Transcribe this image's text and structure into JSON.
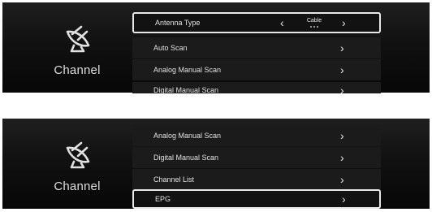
{
  "panels": [
    {
      "sidebar": {
        "icon": "satellite-dish-icon",
        "label": "Channel"
      },
      "menu": [
        {
          "label": "Antenna Type",
          "value": "Cable",
          "selected": true
        },
        {
          "label": "Auto Scan"
        },
        {
          "label": "Analog Manual Scan"
        },
        {
          "label": "Digital Manual Scan"
        }
      ]
    },
    {
      "sidebar": {
        "icon": "satellite-dish-icon",
        "label": "Channel"
      },
      "menu": [
        {
          "label": "Analog Manual Scan"
        },
        {
          "label": "Digital Manual Scan"
        },
        {
          "label": "Channel List"
        },
        {
          "label": "EPG",
          "selected": true
        }
      ]
    }
  ],
  "glyphs": {
    "chevron_left": "‹",
    "chevron_right": "›"
  },
  "colors": {
    "panel_bg": "#111111",
    "highlight_border": "#e8e8e8",
    "text": "#e2e2e2"
  }
}
